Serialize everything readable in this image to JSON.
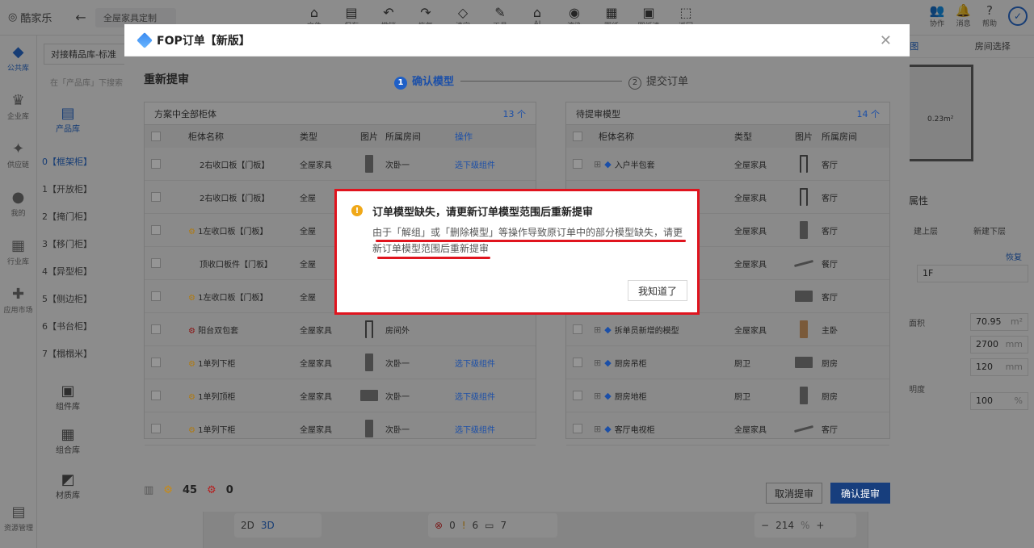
{
  "app": {
    "logo_text": "酷家乐",
    "project_tab": "全屋家具定制",
    "toolbar": [
      {
        "icon": "home-icon",
        "glyph": "⌂",
        "label": "文件"
      },
      {
        "icon": "save-icon",
        "glyph": "▤",
        "label": "保存"
      },
      {
        "icon": "undo-icon",
        "glyph": "↶",
        "label": "撤销"
      },
      {
        "icon": "redo-icon",
        "glyph": "↷",
        "label": "恢复"
      },
      {
        "icon": "eraser-icon",
        "glyph": "◇",
        "label": "清空"
      },
      {
        "icon": "tools-icon",
        "glyph": "✎",
        "label": "工具"
      },
      {
        "icon": "ai-icon",
        "glyph": "⌂",
        "label": "AI"
      },
      {
        "icon": "camera-icon",
        "glyph": "◉",
        "label": "渲染"
      },
      {
        "icon": "drawing-icon",
        "glyph": "▦",
        "label": "图纸"
      },
      {
        "icon": "order-icon",
        "glyph": "▣",
        "label": "图纸清单"
      },
      {
        "icon": "back-icon",
        "glyph": "⬚",
        "label": "返回"
      }
    ],
    "top_right": [
      {
        "icon": "collab-icon",
        "glyph": "👥",
        "label": "协作"
      },
      {
        "icon": "bell-icon",
        "glyph": "🔔",
        "label": "消息"
      },
      {
        "icon": "help-icon",
        "glyph": "?",
        "label": "帮助"
      }
    ],
    "left_rail": [
      {
        "label": "公共库",
        "active": true,
        "glyph": "◆"
      },
      {
        "label": "企业库",
        "glyph": "♛"
      },
      {
        "label": "供应链",
        "glyph": "✦"
      },
      {
        "label": "我的",
        "glyph": "●"
      },
      {
        "label": "行业库",
        "glyph": "▦"
      },
      {
        "label": "应用市场",
        "glyph": "✚"
      },
      {
        "label": "资源管理",
        "glyph": "▤"
      }
    ],
    "lib_select": "对接精品库-标准",
    "lib_search_placeholder": "在「产品库」下搜索",
    "categories": [
      "0【框架柜】",
      "1【开放柜】",
      "2【掩门柜】",
      "3【移门柜】",
      "4【异型柜】",
      "5【侧边柜】",
      "6【书台柜】",
      "7【榻榻米】"
    ],
    "lib_tabs": [
      {
        "label": "产品库",
        "glyph": "▤",
        "active": true
      },
      {
        "label": "组件库",
        "glyph": "▣"
      },
      {
        "label": "组合库",
        "glyph": "▦"
      },
      {
        "label": "材质库",
        "glyph": "◩"
      }
    ],
    "right_panel": {
      "tab1": "视图",
      "tab2": "房间选择",
      "area": "0.23m²",
      "section": "属性",
      "btn_up": "建上层",
      "btn_down": "新建下层",
      "reset": "恢复",
      "floor": "1F",
      "area_label": "面积",
      "fields": [
        {
          "value": "70.95",
          "unit": "m²"
        },
        {
          "value": "2700",
          "unit": "mm"
        },
        {
          "value": "120",
          "unit": "mm"
        },
        {
          "value": "100",
          "unit": "%"
        }
      ],
      "opacity_label": "明度"
    },
    "bottom_toolbar": {
      "view2d": "2D",
      "view3d": "3D",
      "err_count": "0",
      "warn_count": "6",
      "layer_count": "7",
      "zoom": "214",
      "zoom_unit": "%"
    }
  },
  "modal": {
    "title": "FOP订单【新版】",
    "subtitle": "重新提审",
    "step1_num": "1",
    "step1": "确认模型",
    "step2_num": "2",
    "step2": "提交订单",
    "left_table": {
      "title": "方案中全部柜体",
      "count": "13 个",
      "columns": [
        "柜体名称",
        "类型",
        "图片",
        "所属房间",
        "操作"
      ],
      "rows": [
        {
          "name": "2右收口板【门板】",
          "type": "全屋家具",
          "room": "次卧一",
          "op": "选下级组件"
        },
        {
          "name": "2右收口板【门板】",
          "type": "全屋",
          "room": "",
          "op": ""
        },
        {
          "name": "1左收口板【门板】",
          "type": "全屋",
          "room": "",
          "op": ""
        },
        {
          "name": "顶收口板件【门板】",
          "type": "全屋",
          "room": "",
          "op": ""
        },
        {
          "name": "1左收口板【门板】",
          "type": "全屋",
          "room": "",
          "op": ""
        },
        {
          "name": "阳台双包套",
          "type": "全屋家具",
          "room": "房间外",
          "op": ""
        },
        {
          "name": "1单列下柜",
          "type": "全屋家具",
          "room": "次卧一",
          "op": "选下级组件"
        },
        {
          "name": "1单列顶柜",
          "type": "全屋家具",
          "room": "次卧一",
          "op": "选下级组件"
        },
        {
          "name": "1单列下柜",
          "type": "全屋家具",
          "room": "次卧一",
          "op": "选下级组件"
        }
      ]
    },
    "right_table": {
      "title": "待提审模型",
      "count": "14 个",
      "columns": [
        "柜体名称",
        "类型",
        "图片",
        "所属房间"
      ],
      "rows": [
        {
          "name": "入户半包套",
          "type": "全屋家具",
          "room": "客厅"
        },
        {
          "name": "",
          "type": "全屋家具",
          "room": "客厅"
        },
        {
          "name": "",
          "type": "全屋家具",
          "room": "客厅"
        },
        {
          "name": "",
          "type": "全屋家具",
          "room": "餐厅"
        },
        {
          "name": "",
          "type": "",
          "room": "客厅"
        },
        {
          "name": "拆单员新增的模型",
          "type": "全屋家具",
          "room": "主卧"
        },
        {
          "name": "厨房吊柜",
          "type": "厨卫",
          "room": "厨房"
        },
        {
          "name": "厨房地柜",
          "type": "厨卫",
          "room": "厨房"
        },
        {
          "name": "客厅电视柜",
          "type": "全屋家具",
          "room": "客厅"
        }
      ]
    },
    "stat_ok": "45",
    "stat_err": "0",
    "cancel_label": "取消提审",
    "confirm_label": "确认提审"
  },
  "alert": {
    "title": "订单模型缺失，请更新订单模型范围后重新提审",
    "message": "由于「解组」或「删除模型」等操作导致原订单中的部分模型缺失，请更新订单模型范围后重新提审",
    "ok_label": "我知道了"
  },
  "colors": {
    "accent": "#2a6fd6",
    "highlight": "#e0141e",
    "warning": "#f0a818"
  }
}
